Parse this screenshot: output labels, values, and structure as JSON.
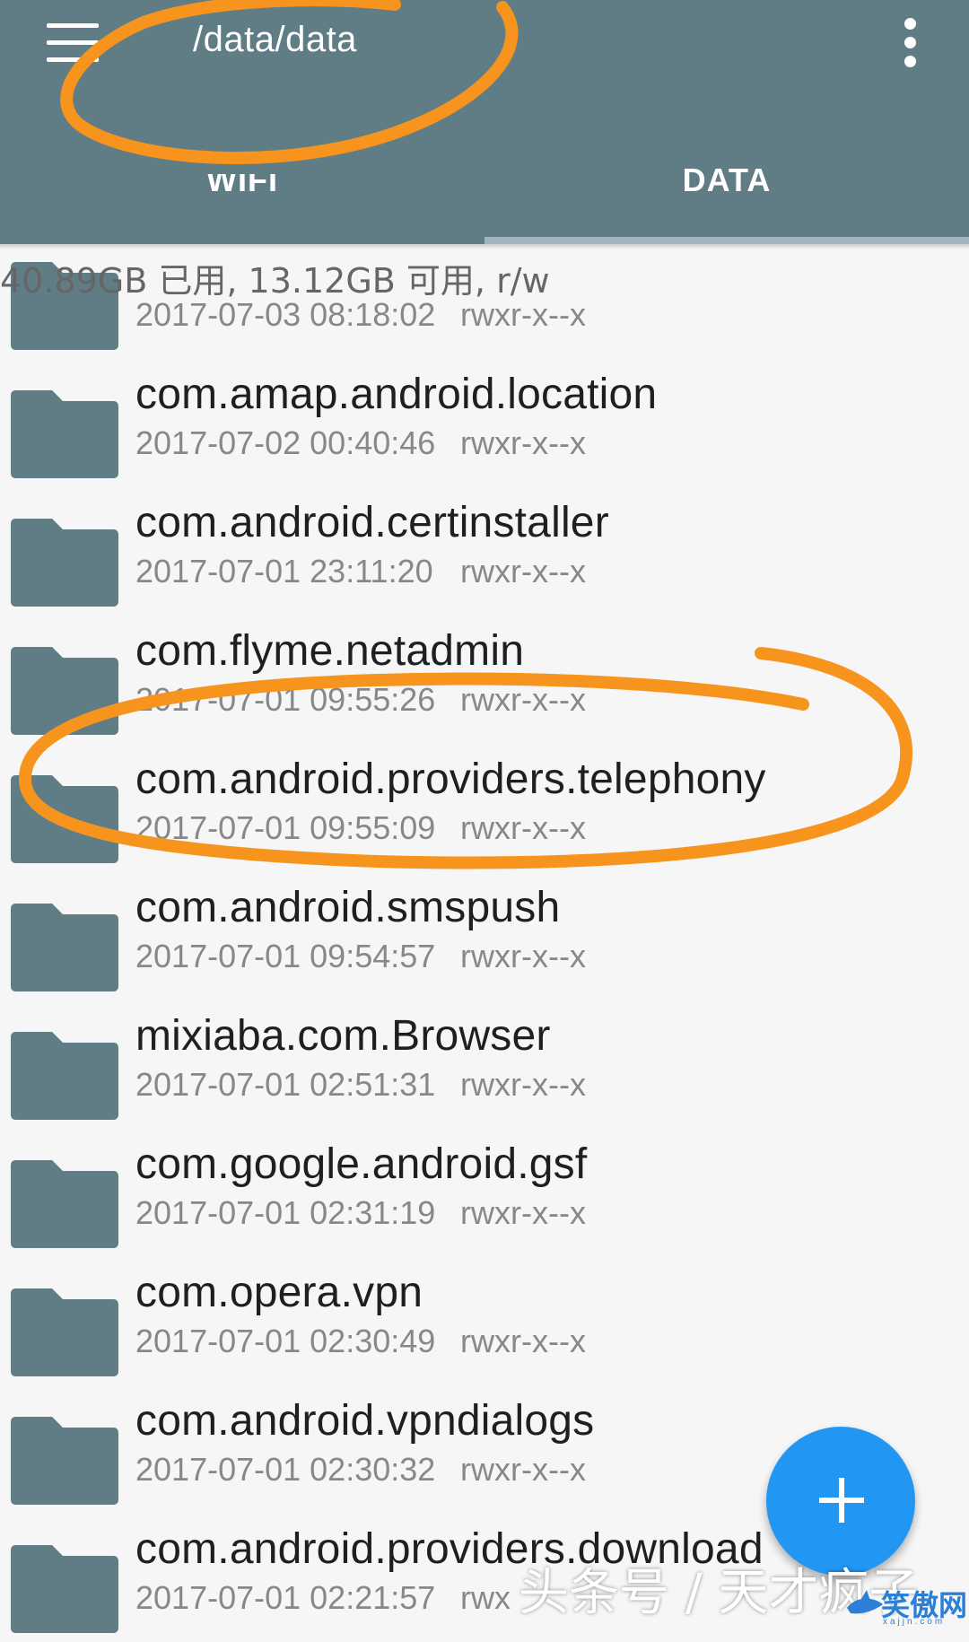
{
  "appbar": {
    "title": "/data/data",
    "tabs": [
      {
        "label": "WIFI",
        "selected": false
      },
      {
        "label": "DATA",
        "selected": true
      }
    ],
    "menu_icon": "hamburger-menu-icon",
    "overflow_icon": "more-vert-icon"
  },
  "storage_info": "40.89GB 已用, 13.12GB 可用, r/w",
  "files": [
    {
      "name": "",
      "date": "2017-07-03 08:18:02",
      "perm": "rwxr-x--x"
    },
    {
      "name": "com.amap.android.location",
      "date": "2017-07-02 00:40:46",
      "perm": "rwxr-x--x"
    },
    {
      "name": "com.android.certinstaller",
      "date": "2017-07-01 23:11:20",
      "perm": "rwxr-x--x"
    },
    {
      "name": "com.flyme.netadmin",
      "date": "2017-07-01 09:55:26",
      "perm": "rwxr-x--x"
    },
    {
      "name": "com.android.providers.telephony",
      "date": "2017-07-01 09:55:09",
      "perm": "rwxr-x--x"
    },
    {
      "name": "com.android.smspush",
      "date": "2017-07-01 09:54:57",
      "perm": "rwxr-x--x"
    },
    {
      "name": "mixiaba.com.Browser",
      "date": "2017-07-01 02:51:31",
      "perm": "rwxr-x--x"
    },
    {
      "name": "com.google.android.gsf",
      "date": "2017-07-01 02:31:19",
      "perm": "rwxr-x--x"
    },
    {
      "name": "com.opera.vpn",
      "date": "2017-07-01 02:30:49",
      "perm": "rwxr-x--x"
    },
    {
      "name": "com.android.vpndialogs",
      "date": "2017-07-01 02:30:32",
      "perm": "rwxr-x--x"
    },
    {
      "name": "com.android.providers.download",
      "date": "2017-07-01 02:21:57",
      "perm": "rwx"
    }
  ],
  "fab_icon": "plus-icon",
  "watermark": "头条号 / 天才疯子",
  "site_logo": {
    "text": "笑傲网",
    "sub": "xajjn.com"
  },
  "colors": {
    "appbar": "#607d86",
    "folder": "#607d86",
    "fab": "#2196f3",
    "annotation": "#f7941d"
  }
}
